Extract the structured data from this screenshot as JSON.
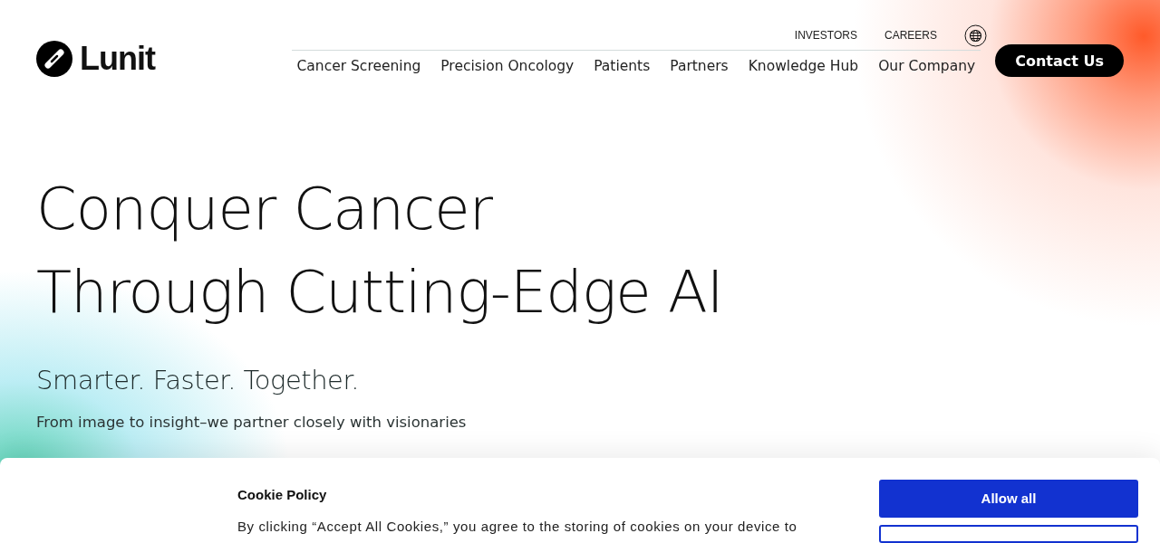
{
  "logo": {
    "text": "Lunit"
  },
  "utility_links": [
    "INVESTORS",
    "CAREERS"
  ],
  "nav": [
    "Cancer Screening",
    "Precision Oncology",
    "Patients",
    "Partners",
    "Knowledge Hub",
    "Our Company"
  ],
  "contact_button": "Contact Us",
  "hero": {
    "title_lines": [
      "Conquer Cancer",
      "Through Cutting-Edge AI"
    ],
    "subtitle": "Smarter. Faster. Together.",
    "text": "From image to insight–we partner closely with visionaries"
  },
  "cookie_banner": {
    "title": "Cookie Policy",
    "text": "By clicking “Accept All Cookies,” you agree to the storing of cookies on your device to",
    "buttons": [
      "Allow all"
    ]
  }
}
